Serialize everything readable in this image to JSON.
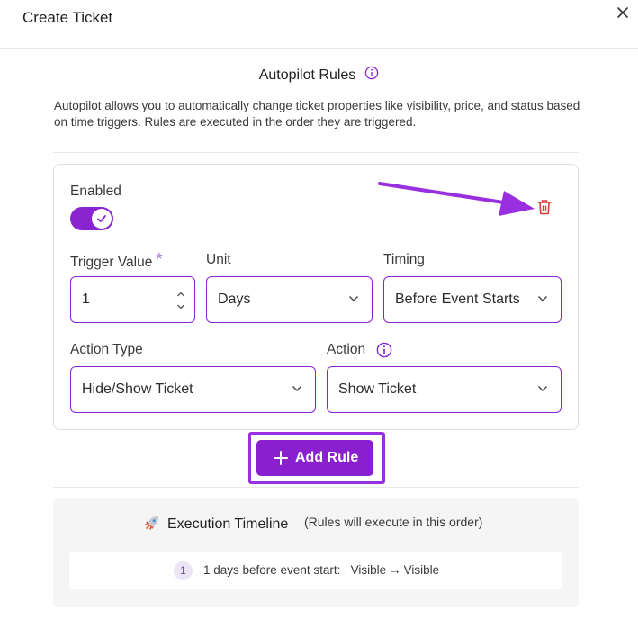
{
  "header": {
    "title": "Create Ticket"
  },
  "section": {
    "title": "Autopilot Rules",
    "description": "Autopilot allows you to automatically change ticket properties like visibility, price, and status based on time triggers. Rules are executed in the order they are triggered."
  },
  "rule": {
    "enabled_label": "Enabled",
    "enabled": true,
    "trigger_value_label": "Trigger Value",
    "required_mark": "*",
    "trigger_value": "1",
    "unit_label": "Unit",
    "unit_value": "Days",
    "timing_label": "Timing",
    "timing_value": "Before Event Starts",
    "action_type_label": "Action Type",
    "action_type_value": "Hide/Show Ticket",
    "action_label": "Action",
    "action_value": "Show Ticket"
  },
  "add_rule_label": "Add Rule",
  "timeline": {
    "title": "Execution Timeline",
    "subtitle": "(Rules will execute in this order)",
    "items": [
      {
        "number": "1",
        "text": "1 days before event start:",
        "from": "Visible",
        "arrow": "→",
        "to": "Visible"
      }
    ]
  },
  "colors": {
    "accent": "#8a24d0",
    "danger": "#d93a3a",
    "annotation_arrow": "#9a2fe0"
  }
}
